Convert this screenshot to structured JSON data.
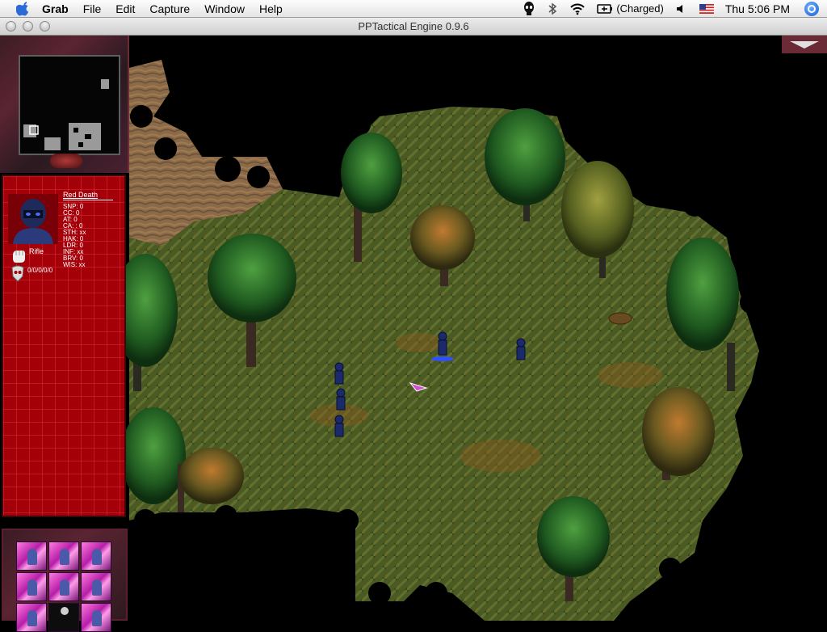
{
  "menubar": {
    "apple_icon": "apple-icon",
    "app_name": "Grab",
    "items": [
      "File",
      "Edit",
      "Capture",
      "Window",
      "Help"
    ],
    "battery_status": "(Charged)",
    "clock": "Thu 5:06 PM",
    "status_icons": [
      "alien-icon",
      "bluetooth-icon",
      "wifi-icon",
      "battery-icon",
      "volume-icon",
      "us-flag-icon",
      "spotlight-icon"
    ]
  },
  "window": {
    "title": "PPTactical Engine 0.9.6"
  },
  "unit": {
    "name": "Red Death",
    "stats": [
      "SNP: 0",
      "CC: 0",
      "AT: 0",
      "CA: : 0",
      "STH: xx",
      "HAK: 0",
      "LDR: 0",
      "INF: xx",
      "BRV: 0",
      "WIS: xx"
    ],
    "weapon": "Rifle",
    "kills": "0/0/0/0/0",
    "accent_color": "#a3000a"
  },
  "squad": {
    "slots": [
      "soldier",
      "soldier",
      "soldier",
      "soldier",
      "soldier",
      "soldier",
      "soldier",
      "dead",
      "soldier"
    ]
  }
}
